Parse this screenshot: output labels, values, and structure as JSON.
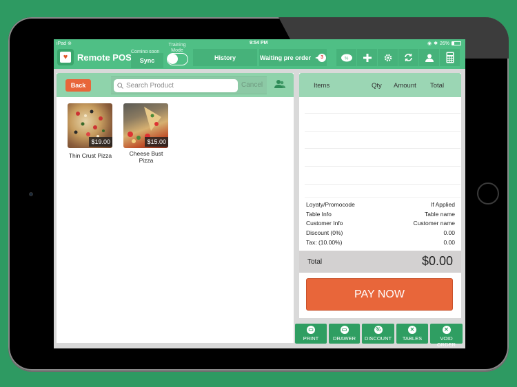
{
  "status_bar": {
    "device": "iPad",
    "time": "9:54 PM",
    "battery_percent": "26%",
    "battery_level": 0.26
  },
  "toolbar": {
    "app_title": "Remote POS",
    "coming_soon": "Coming soon",
    "sync_label": "Sync",
    "training_mode_label": "Training Mode",
    "training_mode_on": false,
    "history_label": "History",
    "waiting_pre_order_label": "Waiting pre order",
    "waiting_pre_order_count": "3",
    "icons": [
      "promo-icon",
      "add-icon",
      "settings-icon",
      "refresh-icon",
      "user-icon",
      "calculator-icon"
    ]
  },
  "left": {
    "back_label": "Back",
    "search_placeholder": "Search Product",
    "cancel_label": "Cancel",
    "products": [
      {
        "name": "Thin Crust Pizza",
        "price": "$19.00"
      },
      {
        "name": "Cheese Bust Pizza",
        "price": "$15.00"
      }
    ]
  },
  "order": {
    "columns": {
      "items": "Items",
      "qty": "Qty",
      "amount": "Amount",
      "total": "Total"
    },
    "summary": [
      {
        "label": "Loyaty/Promocode",
        "value": "If Applied"
      },
      {
        "label": "Table Info",
        "value": "Table name"
      },
      {
        "label": "Customer Info",
        "value": "Customer name"
      },
      {
        "label": "Discount  (0%)",
        "value": "0.00"
      },
      {
        "label": "Tax: (10.00%)",
        "value": "0.00"
      }
    ],
    "total_label": "Total",
    "total_value": "$0.00",
    "pay_label": "PAY NOW"
  },
  "actions": [
    {
      "label": "PRINT",
      "glyph": "▭"
    },
    {
      "label": "DRAWER",
      "glyph": "▭"
    },
    {
      "label": "DISCOUNT",
      "glyph": "%"
    },
    {
      "label": "TABLES",
      "glyph": "✕"
    },
    {
      "label": "VOID ORDER",
      "glyph": "✕"
    }
  ],
  "colors": {
    "brand_green": "#4fbf85",
    "accent_orange": "#e8663a",
    "action_green": "#2f9e62",
    "background": "#2e9a62"
  }
}
